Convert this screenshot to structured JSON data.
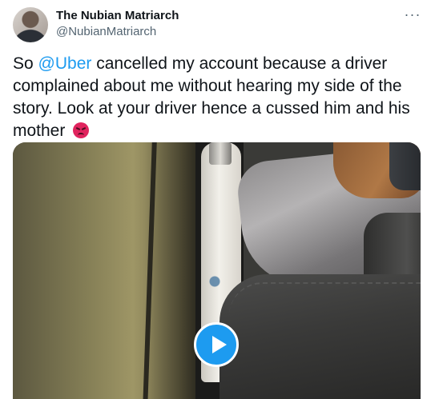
{
  "author": {
    "display_name": "The Nubian Matriarch",
    "handle": "@NubianMatriarch",
    "avatar_icon": "profile-avatar"
  },
  "tweet": {
    "text_before_mention": "So ",
    "mention": "@Uber",
    "text_after_mention": " cancelled my account because a driver complained about me without hearing my side of the story. Look at your driver hence a cussed him and his mother",
    "emoji": "angry-face-emoji"
  },
  "menu": {
    "more_label": "···"
  },
  "media": {
    "type": "video",
    "play_icon": "play-icon"
  },
  "colors": {
    "accent": "#1d9bf0",
    "text_primary": "#0f1419",
    "text_secondary": "#536471"
  }
}
